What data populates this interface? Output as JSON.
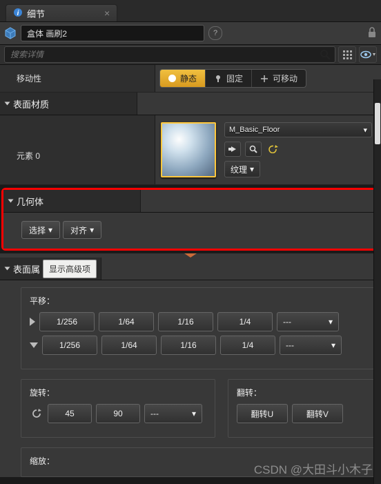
{
  "tab": {
    "title": "细节"
  },
  "header": {
    "object_name": "盒体 画刷2"
  },
  "search": {
    "placeholder": "搜索详情"
  },
  "mobility": {
    "label": "移动性",
    "options": {
      "static": "静态",
      "fixed": "固定",
      "movable": "可移动"
    },
    "active": "static"
  },
  "surface_material": {
    "section": "表面材质",
    "element_label": "元素 0",
    "material_name": "M_Basic_Floor",
    "texture_btn": "纹理"
  },
  "geometry": {
    "section": "几何体",
    "select_btn": "选择",
    "align_btn": "对齐"
  },
  "surface_props": {
    "section": "表面属",
    "show_advanced": "显示高级项",
    "pan": {
      "label": "平移：",
      "values": [
        "1/256",
        "1/64",
        "1/16",
        "1/4"
      ],
      "custom": "---"
    },
    "rotate": {
      "label": "旋转：",
      "values": [
        "45",
        "90"
      ],
      "custom": "---"
    },
    "flip": {
      "label": "翻转：",
      "u": "翻转U",
      "v": "翻转V"
    },
    "scale": {
      "label": "缩放："
    }
  },
  "watermark": "CSDN @大田斗小木子"
}
